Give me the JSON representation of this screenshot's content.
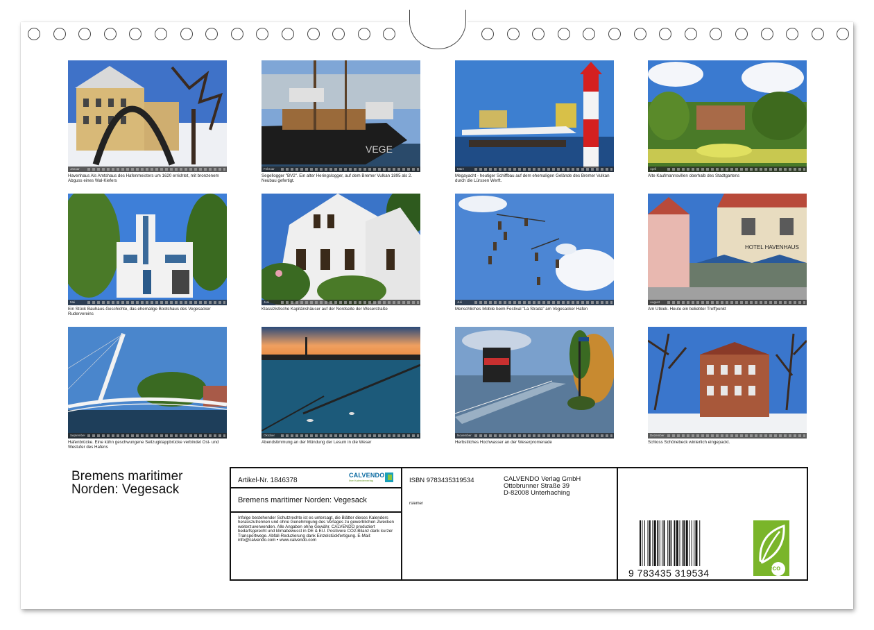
{
  "captions": [
    "Havenhaus  Als Amtshaus des Hafenmeisters um 1620 errichtet, mit bronzenem Abguss eines Wal-Kiefers",
    "Segellogger \"BV2\". Ein alter Heringslogger, auf dem Bremer Vulkan 1895 als 2. Neubau gefertigt.",
    "Megayacht - heutiger Schiffbau auf dem ehemaligen Gelände des Bremer Vulkan durch die Lürssen Werft.",
    "Alte Kaufmannsvillen oberhalb des Stadtgartens",
    "Ein Stück Bauhaus-Geschichte, das ehemalige Bootshaus des Vegesacker Rudervereins",
    "Klassizistische Kapitänshäuser auf der Nordseite der Weserstraße",
    "Menschliches Mobile beim Festival \"La Strada\" am Vegesacker Hafen",
    "Am Utkiek. Heute ein beliebter Treffpunkt",
    "Hafenbrücke. Eine kühn geschwungene Seilzugklappbrücke verbindet Ost- und Westufer des Hafens",
    "Abendstimmung an der Mündung der Lesum in die Weser",
    "Herbstliches Hochwasser an der Weserpromenade",
    "Schloss Schönebeck winterlich eingepackt."
  ],
  "months": [
    "Januar",
    "Februar",
    "März",
    "April",
    "Mai",
    "Juni",
    "Juli",
    "August",
    "September",
    "Oktober",
    "November",
    "Dezember"
  ],
  "cover": {
    "title_line1": "Bremens maritimer",
    "title_line2": "Norden: Vegesack"
  },
  "info": {
    "article": "Artikel-Nr. 1846378",
    "brand": "CALVENDO",
    "brand_sub": "Ihre Kalenderverlag",
    "book_title": "Bremens maritimer Norden: Vegesack",
    "legal": "Infolge bestehender Schutzrechte ist es untersagt, die Blätter dieses Kalenders herauszutrennen und ohne Genehmigung des Verlages zu gewerblichen Zwecken weiterzuverwenden. Alle Angaben ohne Gewähr. CALVENDO produziert bedarfsgerecht und klimabewusst in DE & EU. Positivere CO2-Bilanz dank kurzer Transportwege. Abfall-Reduzierung dank Einzelstückfertigung. E-Mail: info@calvendo.com • www.calvendo.com",
    "isbn": "ISBN 9783435319534",
    "publisher_line1": "CALVENDO Verlag GmbH",
    "publisher_line2": "Ottobrunner Straße 39",
    "publisher_line3": "D-82008 Unterhaching",
    "author": "rsiemer",
    "barcode_number": "9 783435 319534",
    "eco_label": "eco"
  },
  "colors": {
    "eco_green": "#7ab52a",
    "calvendo_blue": "#0a6aa1"
  }
}
